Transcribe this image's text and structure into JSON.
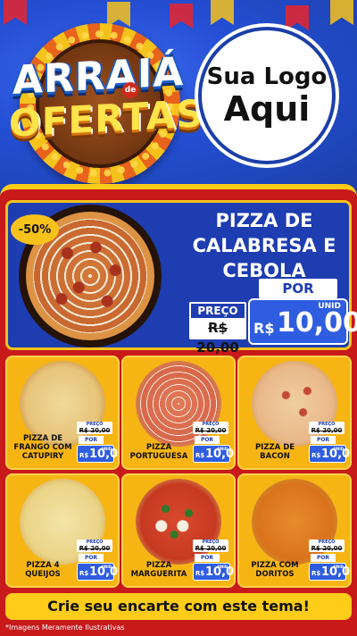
{
  "header": {
    "title_line1": "ARRAIÁ",
    "title_connector": "de",
    "title_line2": "OFERTAS",
    "logo_line1": "Sua Logo",
    "logo_line2": "Aqui"
  },
  "featured": {
    "discount": "-50%",
    "name": "PIZZA DE CALABRESA E CEBOLA",
    "por_label": "POR",
    "preco_label": "PREÇO",
    "old_price": "R$ 20,00",
    "currency": "R$",
    "price": "10,00",
    "unit": "UNID"
  },
  "products": [
    {
      "name": "PIZZA DE FRANGO COM CATUPIRY",
      "preco_label": "PREÇO",
      "old_price": "R$ 20,00",
      "por_label": "POR",
      "currency": "R$",
      "price": "10,00",
      "unit": "UNID"
    },
    {
      "name": "PIZZA PORTUGUESA",
      "preco_label": "PREÇO",
      "old_price": "R$ 20,00",
      "por_label": "POR",
      "currency": "R$",
      "price": "10,00",
      "unit": "UNID"
    },
    {
      "name": "PIZZA DE BACON",
      "preco_label": "PREÇO",
      "old_price": "R$ 20,00",
      "por_label": "POR",
      "currency": "R$",
      "price": "10,00",
      "unit": "UNID"
    },
    {
      "name": "PIZZA 4 QUEIJOS",
      "preco_label": "PREÇO",
      "old_price": "R$ 20,00",
      "por_label": "POR",
      "currency": "R$",
      "price": "10,00",
      "unit": "UNID"
    },
    {
      "name": "PIZZA MARGUERITA",
      "preco_label": "PREÇO",
      "old_price": "R$ 20,00",
      "por_label": "POR",
      "currency": "R$",
      "price": "10,00",
      "unit": "UNID"
    },
    {
      "name": "PIZZA COM DORITOS",
      "preco_label": "PREÇO",
      "old_price": "R$ 20,00",
      "por_label": "POR",
      "currency": "R$",
      "price": "10,00",
      "unit": "UNID"
    }
  ],
  "footer": {
    "cta": "Crie seu encarte com este tema!",
    "disclaimer": "*Imagens Meramente Ilustrativas"
  },
  "colors": {
    "header_blue": "#1b3fa8",
    "body_red": "#c8191b",
    "accent_yellow": "#f7c21c",
    "price_blue": "#2f5de0"
  }
}
